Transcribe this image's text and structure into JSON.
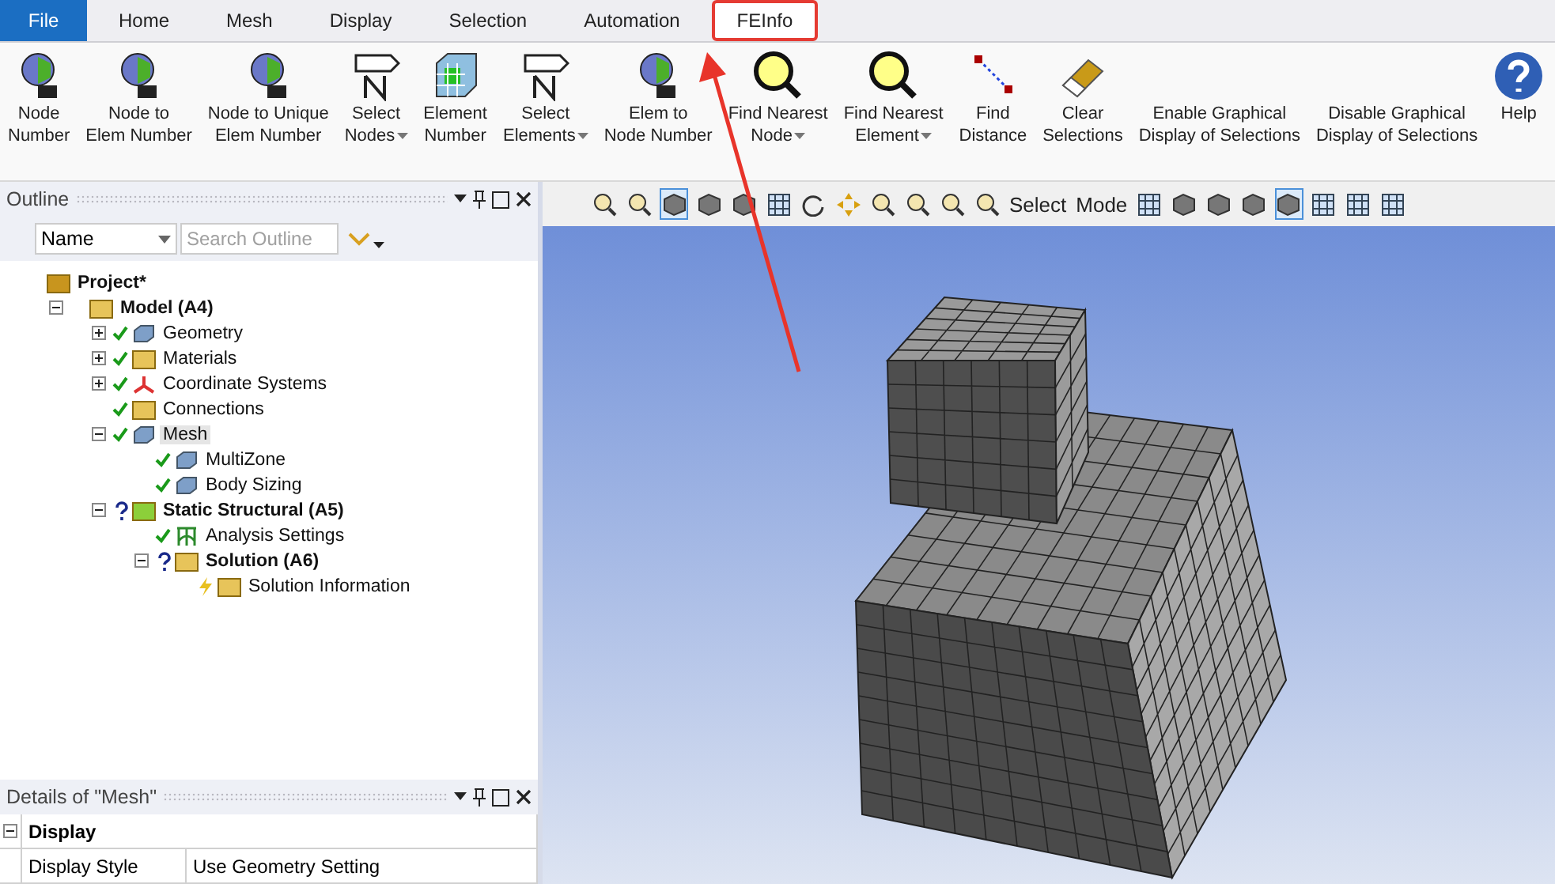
{
  "file_menu": "File",
  "menu_tabs": [
    {
      "label": "Home",
      "selected": false,
      "highlighted": false
    },
    {
      "label": "Mesh",
      "selected": false,
      "highlighted": false
    },
    {
      "label": "Display",
      "selected": false,
      "highlighted": false
    },
    {
      "label": "Selection",
      "selected": false,
      "highlighted": false
    },
    {
      "label": "Automation",
      "selected": false,
      "highlighted": false
    },
    {
      "label": "FEInfo",
      "selected": true,
      "highlighted": true
    }
  ],
  "ribbon": [
    {
      "lines": [
        "Node",
        "Number"
      ],
      "kind": "node",
      "dropdown": false
    },
    {
      "lines": [
        "Node to",
        "Elem Number"
      ],
      "kind": "node",
      "dropdown": false
    },
    {
      "lines": [
        "Node to Unique",
        "Elem Number"
      ],
      "kind": "node",
      "dropdown": false
    },
    {
      "lines": [
        "Select",
        "Nodes"
      ],
      "kind": "tag",
      "dropdown": true
    },
    {
      "lines": [
        "Element",
        "Number"
      ],
      "kind": "element",
      "dropdown": false
    },
    {
      "lines": [
        "Select",
        "Elements"
      ],
      "kind": "tag",
      "dropdown": true
    },
    {
      "lines": [
        "Elem to",
        "Node Number"
      ],
      "kind": "node",
      "dropdown": false
    },
    {
      "lines": [
        "Find Nearest",
        "Node"
      ],
      "kind": "magnifier",
      "dropdown": true
    },
    {
      "lines": [
        "Find Nearest",
        "Element"
      ],
      "kind": "magnifier",
      "dropdown": true
    },
    {
      "lines": [
        "Find",
        "Distance"
      ],
      "kind": "distance",
      "dropdown": false
    },
    {
      "lines": [
        "Clear",
        "Selections"
      ],
      "kind": "eraser",
      "dropdown": false
    },
    {
      "lines": [
        "Enable Graphical",
        "Display of Selections"
      ],
      "kind": "none",
      "dropdown": false
    },
    {
      "lines": [
        "Disable Graphical",
        "Display of Selections"
      ],
      "kind": "none",
      "dropdown": false
    },
    {
      "lines": [
        "Help"
      ],
      "kind": "help",
      "dropdown": false
    }
  ],
  "outline": {
    "title": "Outline",
    "filter": "Name",
    "placeholder": "Search Outline",
    "tree": [
      {
        "label": "Project*",
        "kind": "project",
        "bold": true,
        "selected": false,
        "children": [
          {
            "label": "Model (A4)",
            "kind": "folder",
            "bold": true,
            "selected": false,
            "expanded": true,
            "children": [
              {
                "label": "Geometry",
                "kind": "cube",
                "up_to_date": true,
                "bold": false,
                "selected": false,
                "expanded": false
              },
              {
                "label": "Materials",
                "kind": "folder",
                "up_to_date": true,
                "bold": false,
                "selected": false,
                "expanded": false
              },
              {
                "label": "Coordinate Systems",
                "kind": "axes",
                "up_to_date": true,
                "bold": false,
                "selected": false,
                "expanded": false
              },
              {
                "label": "Connections",
                "kind": "folder",
                "up_to_date": true,
                "bold": false,
                "selected": false
              },
              {
                "label": "Mesh",
                "kind": "cube",
                "up_to_date": true,
                "bold": false,
                "selected": true,
                "expanded": true,
                "children": [
                  {
                    "label": "MultiZone",
                    "kind": "cube",
                    "up_to_date": true,
                    "bold": false,
                    "selected": false
                  },
                  {
                    "label": "Body Sizing",
                    "kind": "cube",
                    "up_to_date": true,
                    "bold": false,
                    "selected": false
                  }
                ]
              },
              {
                "label": "Static Structural (A5)",
                "kind": "static",
                "up_to_date": false,
                "bold": true,
                "selected": false,
                "expanded": true,
                "children": [
                  {
                    "label": "Analysis Settings",
                    "kind": "settings",
                    "up_to_date": true,
                    "bold": false,
                    "selected": false
                  },
                  {
                    "label": "Solution (A6)",
                    "kind": "folder",
                    "up_to_date": false,
                    "bold": true,
                    "selected": false,
                    "expanded": true,
                    "children": [
                      {
                        "label": "Solution Information",
                        "kind": "info",
                        "running": true,
                        "bold": false,
                        "selected": false
                      }
                    ]
                  }
                ]
              }
            ]
          }
        ]
      }
    ]
  },
  "details": {
    "title": "Details of \"Mesh\"",
    "group": "Display",
    "expanded": true,
    "rows": [
      {
        "name": "Display Style",
        "value": "Use Geometry Setting"
      }
    ]
  },
  "view_toolbar": [
    {
      "kind": "zoom",
      "pressed": false
    },
    {
      "kind": "zoom",
      "pressed": false
    },
    {
      "kind": "cube",
      "pressed": true
    },
    {
      "kind": "cube",
      "pressed": false
    },
    {
      "kind": "cube",
      "pressed": false
    },
    {
      "kind": "grid",
      "pressed": false
    },
    {
      "kind": "rotate",
      "pressed": false
    },
    {
      "kind": "pan",
      "pressed": false
    },
    {
      "kind": "zoom",
      "pressed": false
    },
    {
      "kind": "zoom",
      "pressed": false
    },
    {
      "kind": "zoom",
      "pressed": false
    },
    {
      "kind": "zoom",
      "pressed": false
    },
    {
      "kind": "text",
      "label": "Select",
      "pressed": false
    },
    {
      "kind": "text",
      "label": "Mode",
      "pressed": false
    },
    {
      "kind": "grid",
      "pressed": false
    },
    {
      "kind": "cube",
      "pressed": false
    },
    {
      "kind": "cube",
      "pressed": false
    },
    {
      "kind": "cube",
      "pressed": false
    },
    {
      "kind": "cube",
      "pressed": true
    },
    {
      "kind": "grid",
      "pressed": false
    },
    {
      "kind": "grid",
      "pressed": false
    },
    {
      "kind": "grid",
      "pressed": false
    }
  ]
}
